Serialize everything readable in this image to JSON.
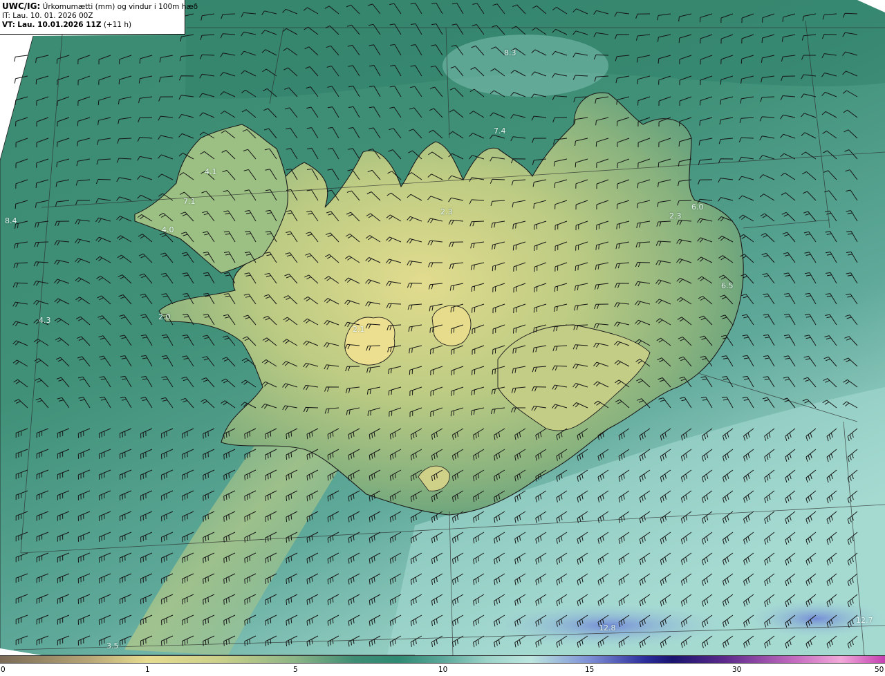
{
  "header": {
    "product": "UWC/IG:",
    "description": "Úrkomumætti (mm) og vindur i 100m hæð",
    "it_label": "IT:",
    "it_value": "Lau. 10. 01. 2026 00Z",
    "vt_label": "VT:",
    "vt_value": "Lau. 10.01.2026 11Z",
    "vt_offset": "(+11 h)"
  },
  "map": {
    "region": "Iceland",
    "field": "precipitable water (mm)",
    "overlay": "wind barbs at 100m",
    "labels": [
      "8.3",
      "7.4",
      "4.1",
      "7.1",
      "4.0",
      "8.4",
      "2.3",
      "6.0",
      "2.3",
      "6.5",
      "4.3",
      "2.0",
      "2.1",
      "3.5",
      "12.8",
      "12.7"
    ]
  },
  "colorbar": {
    "tick_labels": [
      "0",
      "1",
      "5",
      "10",
      "15",
      "30",
      "50"
    ],
    "colors": {
      "low": "#7a6a55",
      "one": "#e7dc90",
      "five": "#3f8c74",
      "ten": "#bce6df",
      "fifteen": "#1a1470",
      "thirty": "#f1a8d9",
      "fifty": "#c43fb0"
    }
  }
}
